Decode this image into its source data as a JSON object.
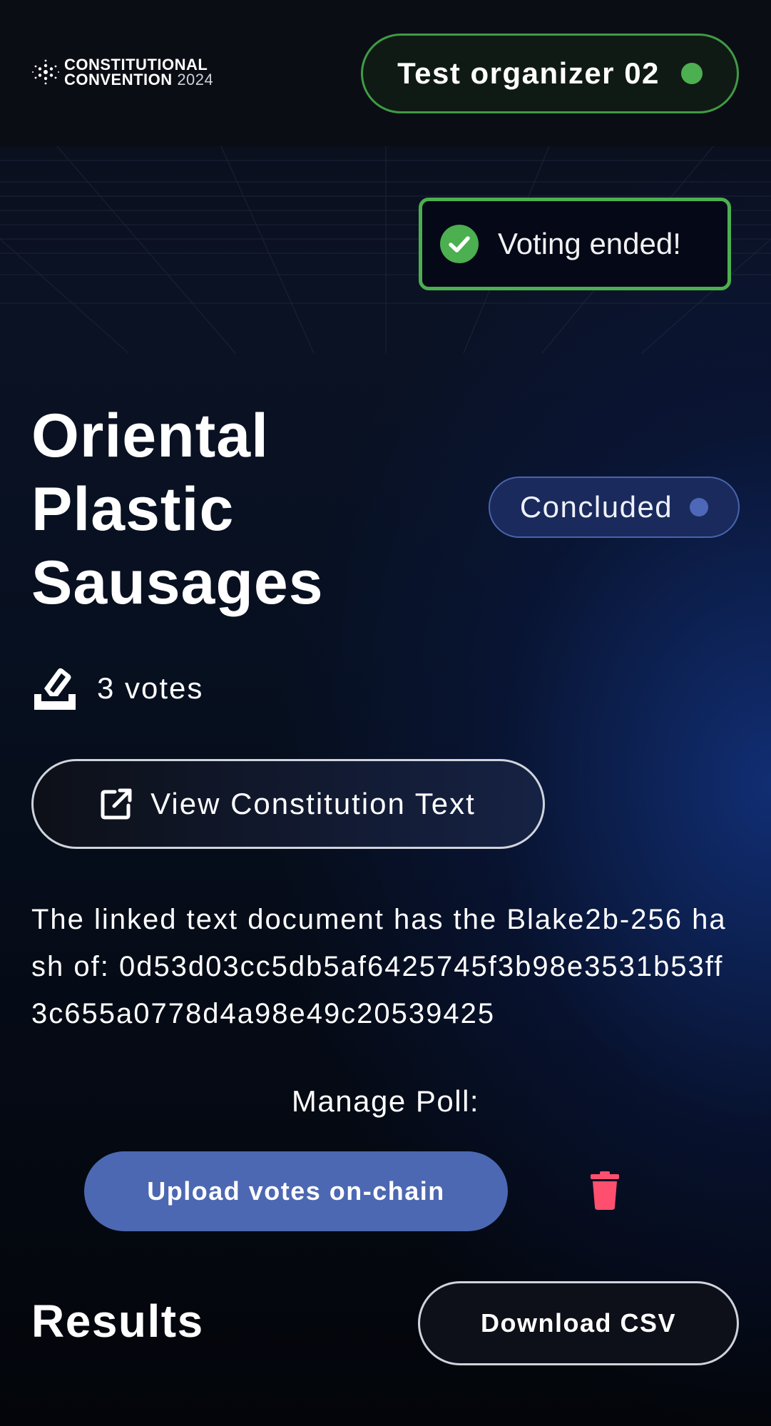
{
  "header": {
    "logo_line1": "CONSTITUTIONAL",
    "logo_line2": "CONVENTION",
    "logo_year": "2024",
    "user_name": "Test organizer 02",
    "user_status_color": "#4caf50"
  },
  "toast": {
    "message": "Voting ended!",
    "icon": "check-circle-icon",
    "color": "#4caf50"
  },
  "poll": {
    "title": "Oriental Plastic Sausages",
    "status": "Concluded",
    "status_color": "#4d68b8",
    "votes": "3 votes",
    "view_button_label": "View Constitution Text",
    "hash_text": "The linked text document has the Blake2b-256 hash of: 0d53d03cc5db5af6425745f3b98e3531b53ff3c655a0778d4a98e49c20539425",
    "manage_label": "Manage Poll:",
    "upload_button_label": "Upload votes on-chain",
    "delete_icon": "trash-icon",
    "delete_color": "#ff4f6e"
  },
  "results": {
    "heading": "Results",
    "download_label": "Download CSV"
  }
}
